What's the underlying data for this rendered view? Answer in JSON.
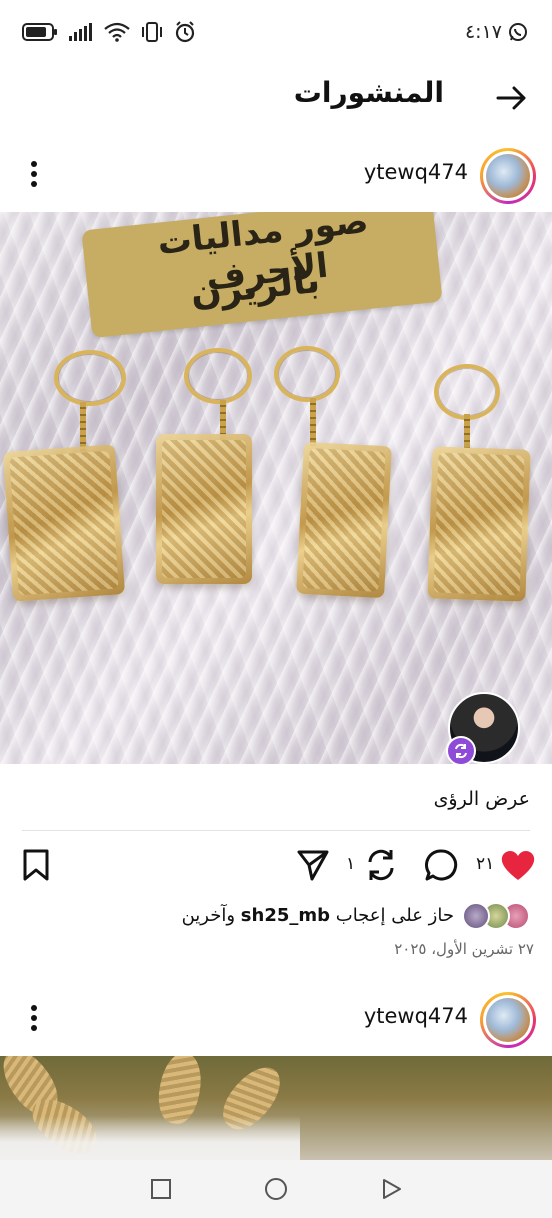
{
  "status_bar": {
    "time": "٤:١٧",
    "icons": [
      "battery-icon",
      "signal-icon",
      "wifi-icon",
      "vibrate-icon",
      "alarm-icon",
      "whatsapp-icon"
    ]
  },
  "header": {
    "title": "المنشورات",
    "back_icon": "arrow-right-icon"
  },
  "posts": [
    {
      "username": "ytewq474",
      "image": {
        "overlay_line1": "صور مداليات الأحرف",
        "overlay_line2": "بالريزن"
      },
      "insights_label": "عرض الرؤى",
      "likes_count": "٢١",
      "repost_count": "١",
      "liked_by": {
        "prefix": "حاز على إعجاب",
        "user": "sh25_mb",
        "suffix": "وآخرين"
      },
      "date": "٢٧ تشرين الأول، ٢٠٢٥"
    },
    {
      "username": "ytewq474"
    }
  ],
  "colors": {
    "like_red": "#e8253f",
    "collab_badge": "#8e4bd8",
    "overlay_gold": "#c7ad63"
  }
}
